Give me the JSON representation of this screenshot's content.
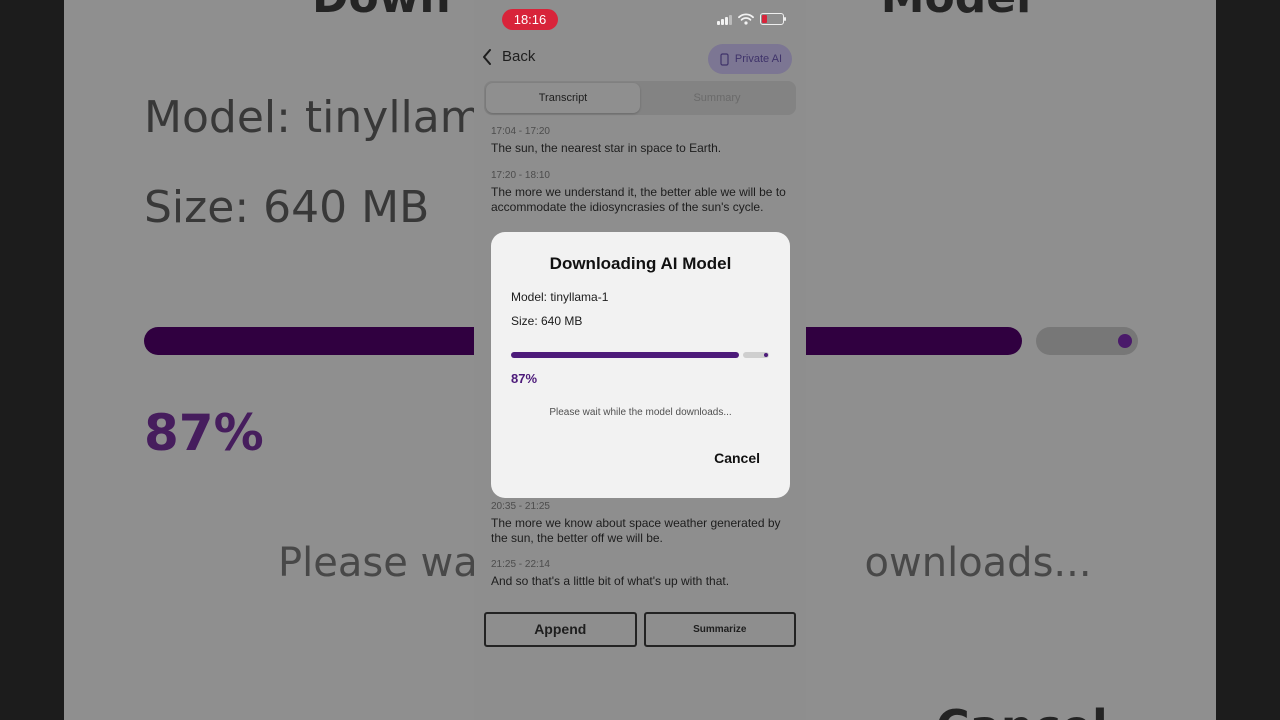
{
  "background_overlay": {
    "title_fragment_left": "Down",
    "title_fragment_right": "Model",
    "model_text": "Model: tinyllama",
    "size_text": "Size: 640 MB",
    "percent_text": "87%",
    "wait_left": "Please wait",
    "wait_right": "ownloads...",
    "cancel_fragment": "Cancel"
  },
  "status_bar": {
    "time": "18:16"
  },
  "header": {
    "back_label": "Back",
    "private_ai_label": "Private AI"
  },
  "tabs": [
    {
      "label": "Transcript",
      "active": true
    },
    {
      "label": "Summary",
      "active": false
    }
  ],
  "transcript": [
    {
      "time": "17:04 - 17:20",
      "text": "The sun, the nearest star in space to Earth."
    },
    {
      "time": "17:20 - 18:10",
      "text": "The more we understand it, the better able we will be to accommodate the idiosyncrasies of the sun's cycle."
    },
    {
      "time": "20:35 - 21:25",
      "text": "The more we know about space weather generated by the sun, the better off we will be."
    },
    {
      "time": "21:25 - 22:14",
      "text": "And so that's a little bit of what's up with that."
    }
  ],
  "bottom_actions": {
    "append_label": "Append",
    "summarize_label": "Summarize"
  },
  "dialog": {
    "title": "Downloading AI Model",
    "model_line": "Model: tinyllama-1",
    "size_line": "Size: 640 MB",
    "progress_fraction": 0.87,
    "percent_label": "87%",
    "wait_message": "Please wait while the model downloads...",
    "cancel_label": "Cancel"
  },
  "colors": {
    "accent": "#4d1b7a",
    "time_pill": "#d8243a",
    "dialog_bg": "#f2f2f2"
  }
}
